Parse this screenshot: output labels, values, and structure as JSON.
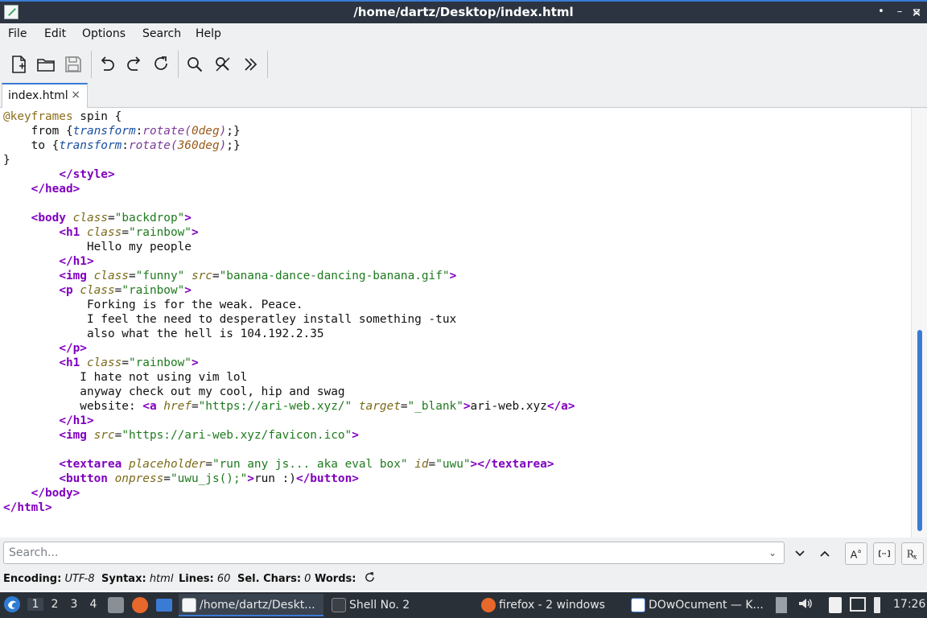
{
  "window": {
    "title": "/home/dartz/Desktop/index.html"
  },
  "menu": [
    "File",
    "Edit",
    "Options",
    "Search",
    "Help"
  ],
  "toolbar": {
    "icons": [
      "new-file-icon",
      "open-folder-icon",
      "save-icon",
      "undo-icon",
      "redo-icon",
      "reload-icon",
      "find-icon",
      "find-replace-icon",
      "more-icon"
    ]
  },
  "tabs": [
    {
      "label": "index.html",
      "close": "×"
    }
  ],
  "code": {
    "lines": [
      [
        [
          "kw",
          "@keyframes"
        ],
        [
          "plain",
          " spin {"
        ]
      ],
      [
        [
          "plain",
          "    from {"
        ],
        [
          "prop",
          "transform"
        ],
        [
          "plain",
          ":"
        ],
        [
          "fn",
          "rotate("
        ],
        [
          "num",
          "0deg"
        ],
        [
          "fn",
          ")"
        ],
        [
          "plain",
          ";}"
        ]
      ],
      [
        [
          "plain",
          "    to {"
        ],
        [
          "prop",
          "transform"
        ],
        [
          "plain",
          ":"
        ],
        [
          "fn",
          "rotate("
        ],
        [
          "num",
          "360deg"
        ],
        [
          "fn",
          ")"
        ],
        [
          "plain",
          ";}"
        ]
      ],
      [
        [
          "plain",
          "}"
        ]
      ],
      [
        [
          "plain",
          "        "
        ],
        [
          "tag",
          "</style>"
        ]
      ],
      [
        [
          "plain",
          "    "
        ],
        [
          "tag",
          "</head>"
        ]
      ],
      [],
      [
        [
          "plain",
          "    "
        ],
        [
          "tag",
          "<body"
        ],
        [
          "plain",
          " "
        ],
        [
          "attr",
          "class"
        ],
        [
          "plain",
          "="
        ],
        [
          "str",
          "\"backdrop\""
        ],
        [
          "tag",
          ">"
        ]
      ],
      [
        [
          "plain",
          "        "
        ],
        [
          "tag",
          "<h1"
        ],
        [
          "plain",
          " "
        ],
        [
          "attr",
          "class"
        ],
        [
          "plain",
          "="
        ],
        [
          "str",
          "\"rainbow\""
        ],
        [
          "tag",
          ">"
        ]
      ],
      [
        [
          "plain",
          "            Hello my people"
        ]
      ],
      [
        [
          "plain",
          "        "
        ],
        [
          "tag",
          "</h1>"
        ]
      ],
      [
        [
          "plain",
          "        "
        ],
        [
          "tag",
          "<img"
        ],
        [
          "plain",
          " "
        ],
        [
          "attr",
          "class"
        ],
        [
          "plain",
          "="
        ],
        [
          "str",
          "\"funny\""
        ],
        [
          "plain",
          " "
        ],
        [
          "attr",
          "src"
        ],
        [
          "plain",
          "="
        ],
        [
          "str",
          "\"banana-dance-dancing-banana.gif\""
        ],
        [
          "tag",
          ">"
        ]
      ],
      [
        [
          "plain",
          "        "
        ],
        [
          "tag",
          "<p"
        ],
        [
          "plain",
          " "
        ],
        [
          "attr",
          "class"
        ],
        [
          "plain",
          "="
        ],
        [
          "str",
          "\"rainbow\""
        ],
        [
          "tag",
          ">"
        ]
      ],
      [
        [
          "plain",
          "            Forking is for the weak. Peace."
        ]
      ],
      [
        [
          "plain",
          "            I feel the need to desperatley install something -tux"
        ]
      ],
      [
        [
          "plain",
          "            also what the hell is 104.192.2.35"
        ]
      ],
      [
        [
          "plain",
          "        "
        ],
        [
          "tag",
          "</p>"
        ]
      ],
      [
        [
          "plain",
          "        "
        ],
        [
          "tag",
          "<h1"
        ],
        [
          "plain",
          " "
        ],
        [
          "attr",
          "class"
        ],
        [
          "plain",
          "="
        ],
        [
          "str",
          "\"rainbow\""
        ],
        [
          "tag",
          ">"
        ]
      ],
      [
        [
          "plain",
          "           I hate not using vim lol"
        ]
      ],
      [
        [
          "plain",
          "           anyway check out my cool, hip and swag"
        ]
      ],
      [
        [
          "plain",
          "           website: "
        ],
        [
          "tag",
          "<a"
        ],
        [
          "plain",
          " "
        ],
        [
          "attr",
          "href"
        ],
        [
          "plain",
          "="
        ],
        [
          "str",
          "\"https://ari-web.xyz/\""
        ],
        [
          "plain",
          " "
        ],
        [
          "attr",
          "target"
        ],
        [
          "plain",
          "="
        ],
        [
          "str",
          "\"_blank\""
        ],
        [
          "tag",
          ">"
        ],
        [
          "plain",
          "ari-web.xyz"
        ],
        [
          "tag",
          "</a>"
        ]
      ],
      [
        [
          "plain",
          "        "
        ],
        [
          "tag",
          "</h1>"
        ]
      ],
      [
        [
          "plain",
          "        "
        ],
        [
          "tag",
          "<img"
        ],
        [
          "plain",
          " "
        ],
        [
          "attr",
          "src"
        ],
        [
          "plain",
          "="
        ],
        [
          "str",
          "\"https://ari-web.xyz/favicon.ico\""
        ],
        [
          "tag",
          ">"
        ]
      ],
      [],
      [
        [
          "plain",
          "        "
        ],
        [
          "tag",
          "<textarea"
        ],
        [
          "plain",
          " "
        ],
        [
          "attr",
          "placeholder"
        ],
        [
          "plain",
          "="
        ],
        [
          "str",
          "\"run any js... aka eval box\""
        ],
        [
          "plain",
          " "
        ],
        [
          "attr",
          "id"
        ],
        [
          "plain",
          "="
        ],
        [
          "str",
          "\"uwu\""
        ],
        [
          "tag",
          "></textarea>"
        ]
      ],
      [
        [
          "plain",
          "        "
        ],
        [
          "tag",
          "<button"
        ],
        [
          "plain",
          " "
        ],
        [
          "attr",
          "onpress"
        ],
        [
          "plain",
          "="
        ],
        [
          "str",
          "\"uwu_js();\""
        ],
        [
          "tag",
          ">"
        ],
        [
          "plain",
          "run :)"
        ],
        [
          "tag",
          "</button>"
        ]
      ],
      [
        [
          "plain",
          "    "
        ],
        [
          "tag",
          "</body>"
        ]
      ],
      [
        [
          "tag",
          "</html>"
        ]
      ]
    ]
  },
  "search": {
    "placeholder": "Search...",
    "value": ""
  },
  "status": {
    "encoding_label": "Encoding:",
    "encoding": "UTF-8",
    "syntax_label": "Syntax:",
    "syntax": "html",
    "lines_label": "Lines:",
    "lines": "60",
    "selchars_label": "Sel. Chars:",
    "selchars": "0",
    "words_label": "Words:"
  },
  "taskbar": {
    "desktops": [
      "1",
      "2",
      "3",
      "4"
    ],
    "tasks": [
      "/home/dartz/Deskt...",
      "Shell No. 2",
      "firefox - 2 windows",
      "DOwOcument — K..."
    ],
    "clock": "17:26"
  }
}
